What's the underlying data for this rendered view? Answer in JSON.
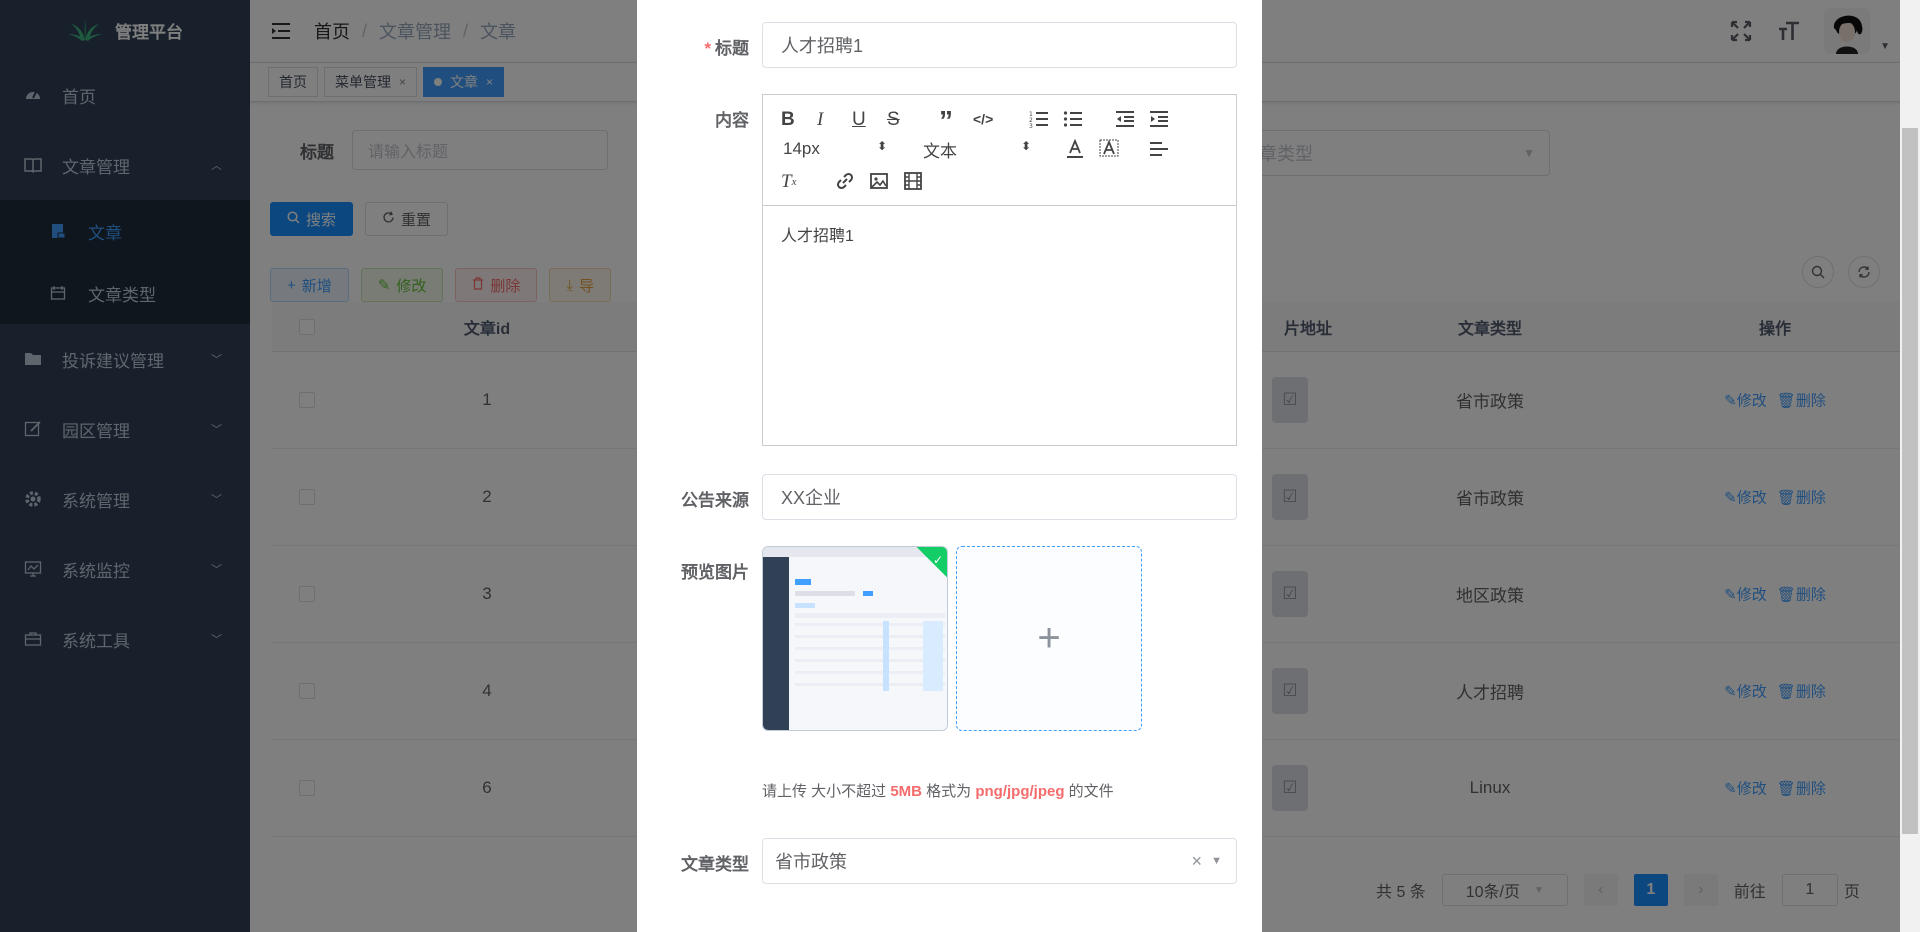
{
  "app": {
    "title": "管理平台"
  },
  "sidebar": {
    "items": [
      {
        "label": "首页",
        "icon": "dashboard-icon"
      },
      {
        "label": "文章管理",
        "icon": "book-icon",
        "expanded": true
      },
      {
        "label": "投诉建议管理",
        "icon": "folder-icon"
      },
      {
        "label": "园区管理",
        "icon": "edit-icon"
      },
      {
        "label": "系统管理",
        "icon": "gear-icon"
      },
      {
        "label": "系统监控",
        "icon": "monitor-icon"
      },
      {
        "label": "系统工具",
        "icon": "toolbox-icon"
      }
    ],
    "sub_items": [
      {
        "label": "文章",
        "active": true
      },
      {
        "label": "文章类型",
        "active": false
      }
    ]
  },
  "navbar": {
    "breadcrumb": [
      "首页",
      "文章管理",
      "文章"
    ]
  },
  "tags": [
    {
      "label": "首页"
    },
    {
      "label": "菜单管理"
    },
    {
      "label": "文章"
    }
  ],
  "search": {
    "title_label": "标题",
    "title_placeholder": "请输入标题",
    "type_placeholder": "章类型",
    "search_btn": "搜索",
    "reset_btn": "重置"
  },
  "toolbar": {
    "add": "新增",
    "edit": "修改",
    "delete": "删除",
    "export": "导"
  },
  "table": {
    "headers": [
      "文章id",
      "片地址",
      "文章类型",
      "操作"
    ],
    "rows": [
      {
        "id": "1",
        "type": "省市政策"
      },
      {
        "id": "2",
        "type": "省市政策"
      },
      {
        "id": "3",
        "type": "地区政策"
      },
      {
        "id": "4",
        "type": "人才招聘"
      },
      {
        "id": "6",
        "type": "Linux"
      }
    ],
    "edit_label": "修改",
    "delete_label": "删除"
  },
  "pagination": {
    "total": "共 5 条",
    "page_size": "10条/页",
    "current_page": "1",
    "goto_label": "前往",
    "goto_value": "1",
    "page_suffix": "页"
  },
  "dialog": {
    "title_label": "标题",
    "title_value": "人才招聘1",
    "content_label": "内容",
    "editor_font_size": "14px",
    "editor_block_type": "文本",
    "editor_text": "人才招聘1",
    "source_label": "公告来源",
    "source_value": "XX企业",
    "image_label": "预览图片",
    "upload_tip_prefix": "请上传 大小不超过 ",
    "upload_tip_size": "5MB",
    "upload_tip_mid": " 格式为 ",
    "upload_tip_formats": "png/jpg/jpeg",
    "upload_tip_suffix": " 的文件",
    "type_label": "文章类型",
    "type_value": "省市政策"
  },
  "colors": {
    "sidebar_bg": "#304156",
    "primary": "#1890ff",
    "danger": "#f56c6c",
    "success": "#13ce66"
  }
}
